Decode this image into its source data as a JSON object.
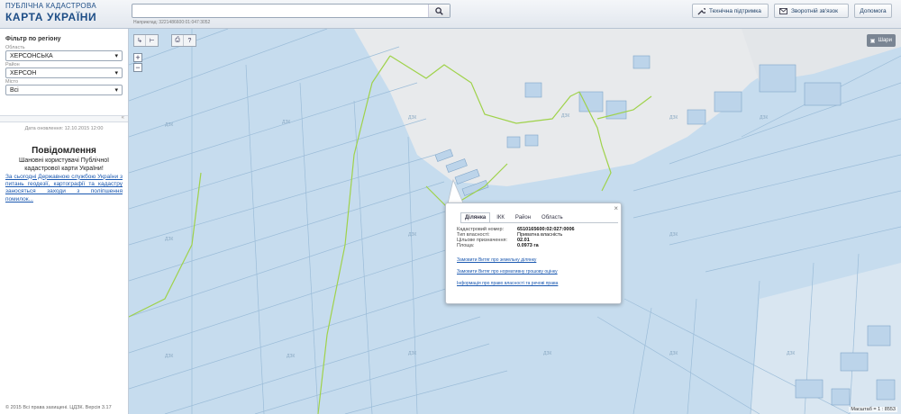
{
  "header": {
    "logo_line1": "ПУБЛІЧНА КАДАСТРОВА",
    "logo_line2": "КАРТА УКРАЇНИ",
    "search_placeholder": "",
    "search_example": "Наприклад: 3221486600:01:047:3052",
    "tech_support": "Технічна підтримка",
    "feedback": "Зворотній зв'язок",
    "help": "Допомога"
  },
  "sidebar": {
    "filter_title": "Фільтр по регіону",
    "oblast_label": "Область",
    "oblast_value": "ХЕРСОНСЬКА",
    "rayon_label": "Район",
    "rayon_value": "ХЕРСОН",
    "misto_label": "Місто",
    "misto_value": "Всі",
    "updated": "Дата оновлення: 12.10.2015 12:00",
    "message_title": "Повідомлення",
    "message_body": "Шановні користувачі Публічної кадастрової карти України!",
    "message_link": "За сьогодні Державною службою України з питань геодезії, картографії та кадастру заносяться заходи з поліпшення помилок...",
    "footer": "© 2015 Всі права захищені. ЦДЗК. Версія 3.17"
  },
  "map": {
    "layers_label": "Шари",
    "scale": "Масштаб = 1 : 8553",
    "watermark": "ДЗК"
  },
  "popup": {
    "tabs": [
      "Ділянка",
      "ІКК",
      "Район",
      "Область"
    ],
    "rows": [
      {
        "key": "Кадастровий номер:",
        "value": "6510165600:02:027:0006"
      },
      {
        "key": "Тип власності:",
        "value": "Приватна власність"
      },
      {
        "key": "Цільове призначення:",
        "value": "02.01"
      },
      {
        "key": "Площа:",
        "value": "0.0973 га"
      }
    ],
    "links": [
      "Замовити Витяг про земельну ділянку",
      "Замовити Витяг про нормативну грошову оцінку",
      "Інформація про право власності та речові права"
    ]
  }
}
